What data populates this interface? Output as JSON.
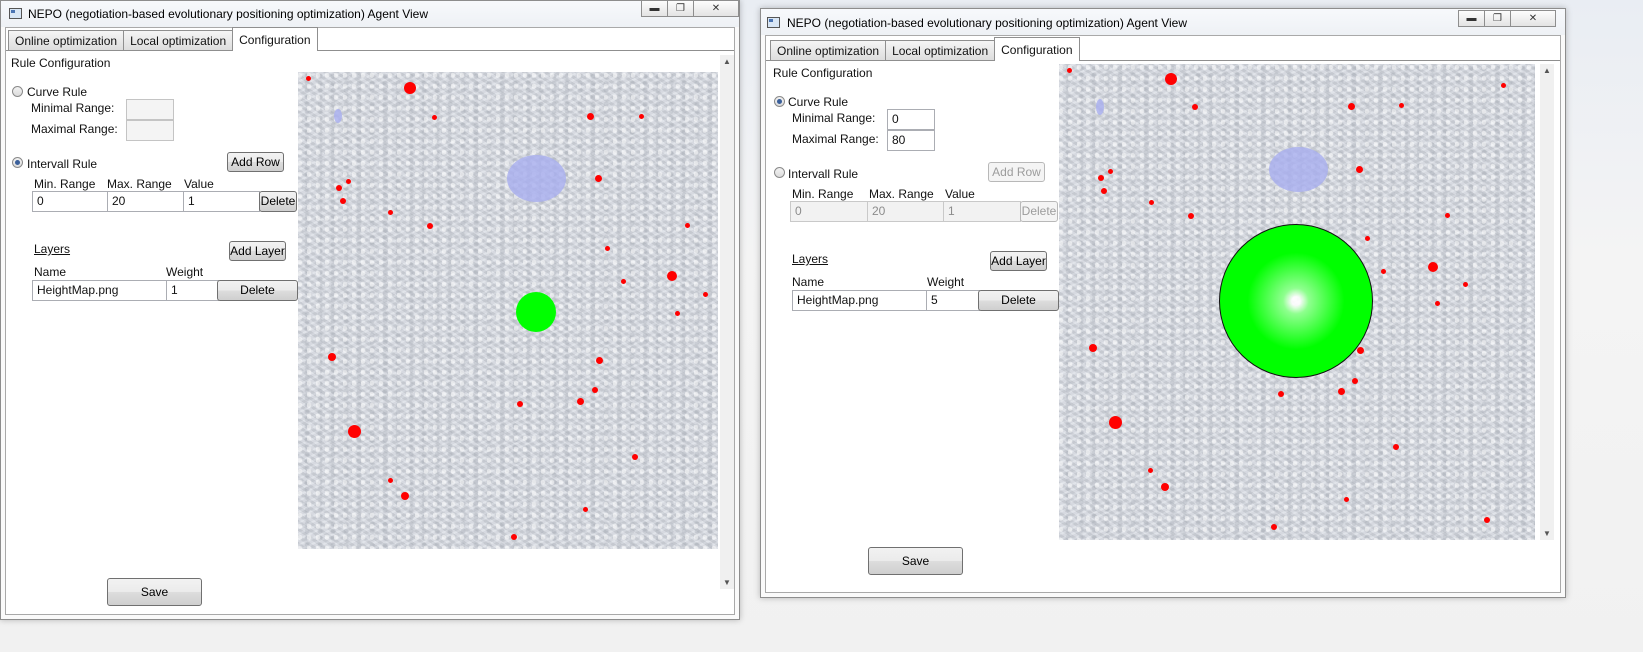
{
  "window_title": "NEPO (negotiation-based evolutionary positioning optimization) Agent View",
  "tabs": [
    "Online optimization",
    "Local optimization",
    "Configuration"
  ],
  "section_title": "Rule Configuration",
  "curve_rule_label": "Curve Rule",
  "minimal_range_label": "Minimal Range:",
  "maximal_range_label": "Maximal Range:",
  "interval_rule_label": "Intervall Rule",
  "add_row_label": "Add Row",
  "col_min_range": "Min. Range",
  "col_max_range": "Max. Range",
  "col_value": "Value",
  "delete_label": "Delete",
  "layers_label": "Layers",
  "add_layer_label": "Add Layer",
  "col_name": "Name",
  "col_weight": "Weight",
  "save_label": "Save",
  "left_window": {
    "selected_rule": "interval",
    "curve_min": "",
    "curve_max": "",
    "interval_row": {
      "min": "0",
      "max": "20",
      "value": "1"
    },
    "layer": {
      "name": "HeightMap.png",
      "weight": "1"
    }
  },
  "right_window": {
    "selected_rule": "curve",
    "curve_min": "0",
    "curve_max": "80",
    "interval_row": {
      "min": "0",
      "max": "20",
      "value": "1"
    },
    "layer": {
      "name": "HeightMap.png",
      "weight": "5"
    }
  },
  "colors": {
    "obstacle": "#ff0000",
    "agent": "#00ff00",
    "target_zone": "#a7aeef"
  },
  "icons": [
    "app-icon",
    "minimize-icon",
    "maximize-icon",
    "close-icon",
    "scroll-up-icon",
    "scroll-down-icon"
  ]
}
